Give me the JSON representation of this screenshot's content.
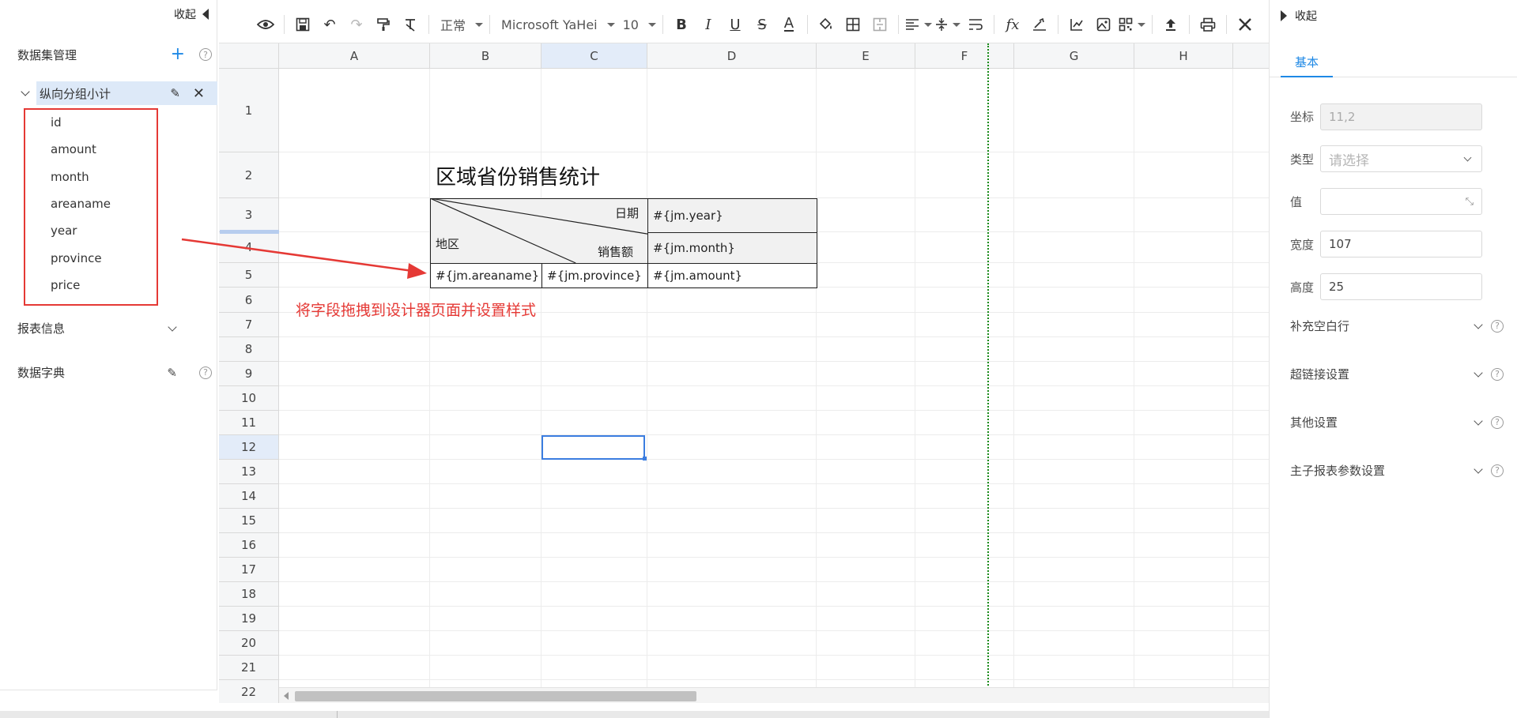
{
  "left_panel": {
    "collapse_label": "收起",
    "dataset_section": {
      "label": "数据集管理",
      "add_icon": "plus-icon",
      "help": "?"
    },
    "dataset": {
      "name": "纵向分组小计",
      "fields": [
        "id",
        "amount",
        "month",
        "areaname",
        "year",
        "province",
        "price"
      ]
    },
    "report_info_label": "报表信息",
    "dictionary_label": "数据字典",
    "help": "?"
  },
  "toolbar": {
    "font_style": "正常",
    "font_family": "Microsoft YaHei",
    "font_size": "10",
    "fx_label": "fx",
    "bold": "B",
    "italic": "I",
    "underline": "U",
    "strike": "S",
    "font_color": "A"
  },
  "sheet": {
    "columns": [
      "A",
      "B",
      "C",
      "D",
      "E",
      "F",
      "G",
      "H"
    ],
    "selected_column": "C",
    "rows": [
      "1",
      "2",
      "3",
      "4",
      "5",
      "6",
      "7",
      "8",
      "9",
      "10",
      "11",
      "12",
      "13",
      "14",
      "15",
      "16",
      "17",
      "18",
      "19",
      "20",
      "21",
      "22"
    ],
    "selected_row": "12",
    "title": "区域省份销售统计",
    "header_date": "日期",
    "header_region": "地区",
    "header_sales": "销售额",
    "cell_year": "#{jm.year}",
    "cell_month": "#{jm.month}",
    "cell_areaname": "#{jm.areaname}",
    "cell_province": "#{jm.province}",
    "cell_amount": "#{jm.amount}",
    "hint": "将字段拖拽到设计器页面并设置样式",
    "accent_color": "#e53935",
    "selection_color": "#3b7de0"
  },
  "right_panel": {
    "collapse_label": "收起",
    "tab_basic": "基本",
    "coord_label": "坐标",
    "coord_value": "11,2",
    "type_label": "类型",
    "type_placeholder": "请选择",
    "value_label": "值",
    "value_value": "",
    "width_label": "宽度",
    "width_value": "107",
    "height_label": "高度",
    "height_value": "25",
    "sections": [
      "补充空白行",
      "超链接设置",
      "其他设置",
      "主子报表参数设置"
    ],
    "help": "?"
  }
}
